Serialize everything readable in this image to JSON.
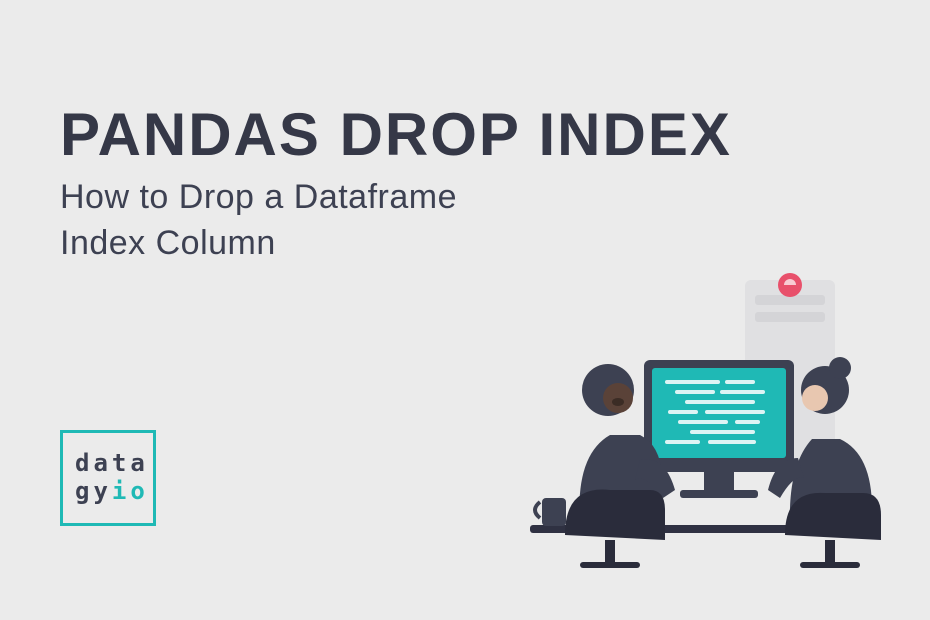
{
  "title": "PANDAS DROP INDEX",
  "subtitle_line1": "How to Drop a Dataframe",
  "subtitle_line2": "Index Column",
  "logo": {
    "line1": "data",
    "line2_part1": "gy",
    "line2_part2": "io"
  },
  "colors": {
    "bg": "#ebebeb",
    "dark": "#353847",
    "body": "#3d4152",
    "teal": "#1fb9b5",
    "accent": "#e8506b"
  }
}
